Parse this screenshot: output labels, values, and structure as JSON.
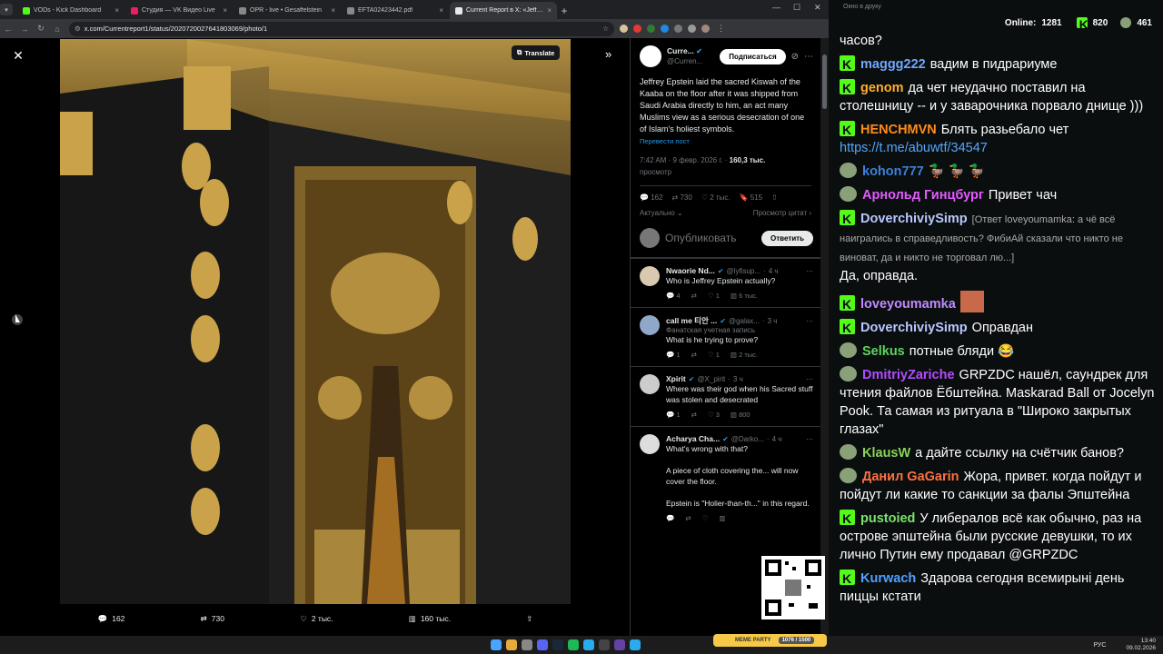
{
  "browser": {
    "tabs": [
      {
        "title": "VODs - Kick Dashboard",
        "color": "#53fc18"
      },
      {
        "title": "Студия — VK Видео Live",
        "color": "#e91e63"
      },
      {
        "title": "OPR - live • Gesaffelstein",
        "color": "#888888"
      },
      {
        "title": "EFTA02423442.pdf",
        "color": "#888888"
      },
      {
        "title": "Current Report в X: «Jeffrey Ep...",
        "color": "#e7e9ea",
        "active": true
      }
    ],
    "url": "x.com/Currentreport1/status/2020720027641803069/photo/1"
  },
  "viewer": {
    "translate_label": "Translate",
    "actions": {
      "replies": "162",
      "reposts": "730",
      "likes": "2 тыс.",
      "views": "160 тыс."
    }
  },
  "tweet": {
    "author_name": "Curre...",
    "author_handle": "@Curren...",
    "follow_label": "Подписаться",
    "text": "Jeffrey Epstein laid the sacred Kiswah of the Kaaba on the floor after it was shipped from Saudi Arabia directly to him, an act many Muslims view as a serious desecration of one of Islam's holiest symbols.",
    "translate_post": "Перевести пост",
    "time": "7:42 AM · 9 февр. 2026 г. ·",
    "views_count": "160,3 тыс.",
    "views_label": "просмотр",
    "stats": {
      "replies": "162",
      "reposts": "730",
      "likes": "2 тыс.",
      "bookmarks": "515"
    },
    "sort_label": "Актуально",
    "quotes_label": "Просмотр цитат",
    "reply_placeholder": "Опубликовать",
    "reply_button": "Ответить"
  },
  "replies": [
    {
      "name": "Nwaorie Nd...",
      "handle": "@lyfisup...",
      "time": "4 ч",
      "text": "Who is Jeffrey Epstein actually?",
      "stats": [
        "4",
        "",
        "1",
        "6 тыс."
      ],
      "avatar": "#d9c9b0"
    },
    {
      "name": "call me 티안 ...",
      "handle": "@galax...",
      "time": "3 ч",
      "sub": "Фанатская учетная запись",
      "text": "What is he trying to prove?",
      "stats": [
        "1",
        "",
        "1",
        "2 тыс."
      ],
      "avatar": "#8fa7c8"
    },
    {
      "name": "Xpirit",
      "handle": "@X_pirit",
      "time": "3 ч",
      "text": "Where was their god when his Sacred stuff was stolen and desecrated",
      "stats": [
        "1",
        "",
        "3",
        "800"
      ],
      "avatar": "#cccccc"
    },
    {
      "name": "Acharya Cha...",
      "handle": "@Darko...",
      "time": "4 ч",
      "text": "What's wrong with that?\n\nA piece of cloth covering the... will now cover the floor.\n\nEpstein is \"Holier-than-th...\" in this regard.",
      "stats": [
        "",
        "",
        "",
        ""
      ],
      "avatar": "#dddddd"
    }
  ],
  "chat": {
    "window_title": "Окно в друку",
    "online_label": "Online:",
    "online_count": "1281",
    "kick_count": "820",
    "other_count": "461",
    "messages": [
      {
        "badge": "",
        "user": "",
        "color": "#ffffff",
        "text": "часов?"
      },
      {
        "badge": "k",
        "user": "maggg222",
        "color": "#6fa8ff",
        "text": "вадим в пидрариуме"
      },
      {
        "badge": "k",
        "user": "genom",
        "color": "#ffb02e",
        "text": "да чет неудачно поставил на столешницу -- и у заварочника порвало днище )))"
      },
      {
        "badge": "k",
        "user": "HENCHMVN",
        "color": "#ff8c1a",
        "text": "Блять разьебало чет",
        "link": "https://t.me/abuwtf/34547"
      },
      {
        "badge": "u",
        "user": "kohon777",
        "color": "#3f7fd9",
        "text": "🦆 🦆 🦆"
      },
      {
        "badge": "u",
        "user": "Арнольд Гинцбург",
        "color": "#e35bff",
        "text": "Привет чач"
      },
      {
        "badge": "k",
        "user": "DoverchiviySimp",
        "color": "#b8c8ff",
        "text": "[Ответ loveyoumamka: а чё всё наигрались в справедливость? ФибиАй сказали что никто не виноват, да и никто не торговал лю...]",
        "text2": "Да, оправда."
      },
      {
        "badge": "k",
        "user": "loveyoumamka",
        "color": "#c08bff",
        "text": ""
      },
      {
        "badge": "k",
        "user": "DoverchiviySimp",
        "color": "#b8c8ff",
        "text": "Оправдан"
      },
      {
        "badge": "u",
        "user": "Selkus",
        "color": "#5fd35f",
        "text": "потные бляди 😂"
      },
      {
        "badge": "u",
        "user": "DmitriyZariche",
        "color": "#b44bff",
        "text": "GRPZDC нашёл, саундрек для чтения файлов Ёбштейна. Maskarad Ball от Jocelyn Pook. Та самая из ритуала в \"Широко закрытых глазах\""
      },
      {
        "badge": "u",
        "user": "KlausW",
        "color": "#8ad35a",
        "text": "а дайте ссылку на счётчик банов?"
      },
      {
        "badge": "u",
        "user": "Данил GaGarin",
        "color": "#ff7043",
        "text": "Жора, привет. когда пойдут и пойдут ли какие то санкции за фалы Эпштейна"
      },
      {
        "badge": "k",
        "user": "pustoied",
        "color": "#7be36b",
        "text": "У либералов всё как обычно, раз на острове эпштейна были русские девушки, то их лично Путин ему продавал @GRPZDC"
      },
      {
        "badge": "k",
        "user": "Kurwach",
        "color": "#4fa0ff",
        "text": "Здарова сегодня всемирыні день пиццы кстати"
      }
    ]
  },
  "taskbar": {
    "lang": "РУС",
    "time": "13:40",
    "date": "09.02.2026",
    "meme_label": "MEME PARTY",
    "meme_progress": "1076 / 1500"
  }
}
